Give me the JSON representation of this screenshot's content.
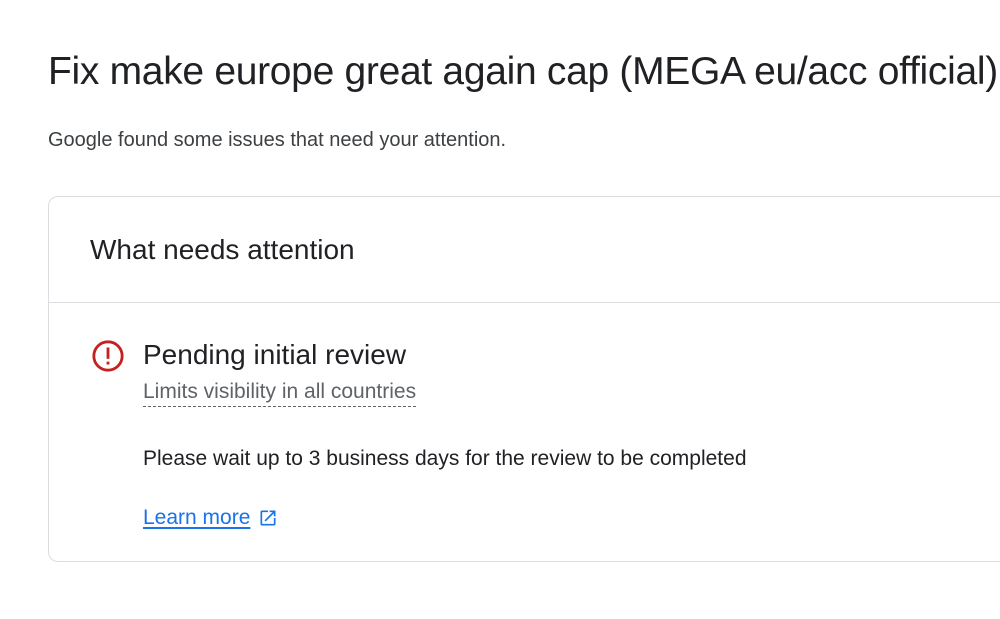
{
  "page": {
    "title": "Fix make europe great again cap (MEGA eu/acc official)",
    "subtitle": "Google found some issues that need your attention."
  },
  "card": {
    "title": "What needs attention",
    "issue": {
      "icon": "error-icon",
      "title": "Pending initial review",
      "impact": "Limits visibility in all countries",
      "description": "Please wait up to 3 business days for the review to be completed",
      "link_label": "Learn more",
      "link_icon": "open-in-new-icon"
    }
  },
  "colors": {
    "error": "#c5221f",
    "link": "#1a73e8",
    "text": "#202124",
    "secondary_text": "#5f6368",
    "border": "#dadce0"
  }
}
